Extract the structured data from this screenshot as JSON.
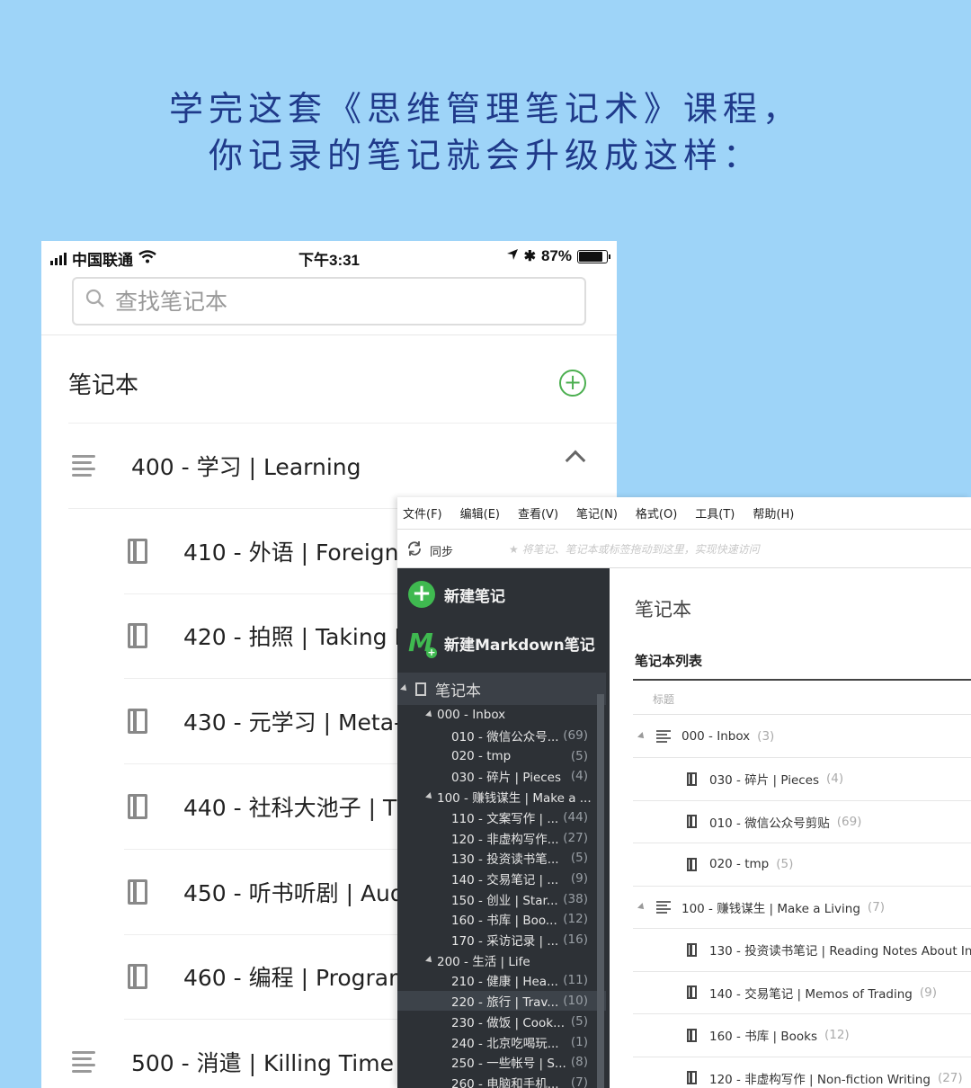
{
  "headline": {
    "line1": "学完这套《思维管理笔记术》课程，",
    "line2": "你记录的笔记就会升级成这样："
  },
  "phone": {
    "status": {
      "carrier": "中国联通",
      "time": "下午3:31",
      "battery": "87%",
      "battery_level": 0.87
    },
    "search_placeholder": "查找笔记本",
    "section_title": "笔记本",
    "rows": [
      {
        "label": "400 - 学习 | Learning",
        "type": "stack"
      },
      {
        "label": "410 - 外语 | Foreign I",
        "type": "book"
      },
      {
        "label": "420 - 拍照 | Taking P",
        "type": "book"
      },
      {
        "label": "430 - 元学习 | Meta-",
        "type": "book"
      },
      {
        "label": "440 - 社科大池子 | T",
        "type": "book"
      },
      {
        "label": "450 - 听书听剧 | Aud",
        "type": "book"
      },
      {
        "label": "460 - 编程 | Program",
        "type": "book"
      },
      {
        "label": "500 - 消遣 | Killing Time",
        "type": "stack"
      }
    ]
  },
  "desktop": {
    "menu": [
      "文件(F)",
      "编辑(E)",
      "查看(V)",
      "笔记(N)",
      "格式(O)",
      "工具(T)",
      "帮助(H)"
    ],
    "sync_label": "同步",
    "quick_access": "将笔记、笔记本或标签拖动到这里，实现快速访问",
    "new_note": "新建笔记",
    "new_markdown": "新建Markdown笔记",
    "notebooks_label": "笔记本",
    "tree": [
      {
        "label": "000 - Inbox",
        "count": ""
      },
      {
        "label": "010 - 微信公众号...",
        "count": "(69)"
      },
      {
        "label": "020 - tmp",
        "count": "(5)"
      },
      {
        "label": "030 - 碎片 | Pieces",
        "count": "(4)"
      },
      {
        "label": "100 - 赚钱谋生 | Make a ...",
        "count": ""
      },
      {
        "label": "110 - 文案写作 | ...",
        "count": "(44)"
      },
      {
        "label": "120 - 非虚构写作...",
        "count": "(27)"
      },
      {
        "label": "130 - 投资读书笔...",
        "count": "(5)"
      },
      {
        "label": "140 - 交易笔记 | ...",
        "count": "(9)"
      },
      {
        "label": "150 - 创业 | Star...",
        "count": "(38)"
      },
      {
        "label": "160 - 书库 | Boo...",
        "count": "(12)"
      },
      {
        "label": "170 - 采访记录 | ...",
        "count": "(16)"
      },
      {
        "label": "200 - 生活 | Life",
        "count": ""
      },
      {
        "label": "210 - 健康 | Hea...",
        "count": "(11)"
      },
      {
        "label": "220 - 旅行 | Trav...",
        "count": "(10)"
      },
      {
        "label": "230 - 做饭 | Cook...",
        "count": "(5)"
      },
      {
        "label": "240 - 北京吃喝玩...",
        "count": "(1)"
      },
      {
        "label": "250 - 一些帐号 | S...",
        "count": "(8)"
      },
      {
        "label": "260 - 电脑和手机...",
        "count": "(7)"
      }
    ],
    "right": {
      "title": "笔记本",
      "subtitle": "笔记本列表",
      "column": "标题",
      "rows": [
        {
          "label": "000 - Inbox",
          "count": "(3)"
        },
        {
          "label": "030 - 碎片 | Pieces",
          "count": "(4)"
        },
        {
          "label": "010 - 微信公众号剪贴",
          "count": "(69)"
        },
        {
          "label": "020 - tmp",
          "count": "(5)"
        },
        {
          "label": "100 - 赚钱谋生 | Make a Living",
          "count": "(7)"
        },
        {
          "label": "130 - 投资读书笔记 | Reading Notes About In",
          "count": ""
        },
        {
          "label": "140 - 交易笔记 | Memos of Trading",
          "count": "(9)"
        },
        {
          "label": "160 - 书库 | Books",
          "count": "(12)"
        },
        {
          "label": "120 - 非虚构写作 | Non-fiction Writing",
          "count": "(27)"
        }
      ]
    }
  },
  "colors": {
    "background": "#9ed4f8",
    "headline": "#1f3a8a",
    "accent_green": "#3fb950",
    "sidebar": "#2d3136"
  }
}
